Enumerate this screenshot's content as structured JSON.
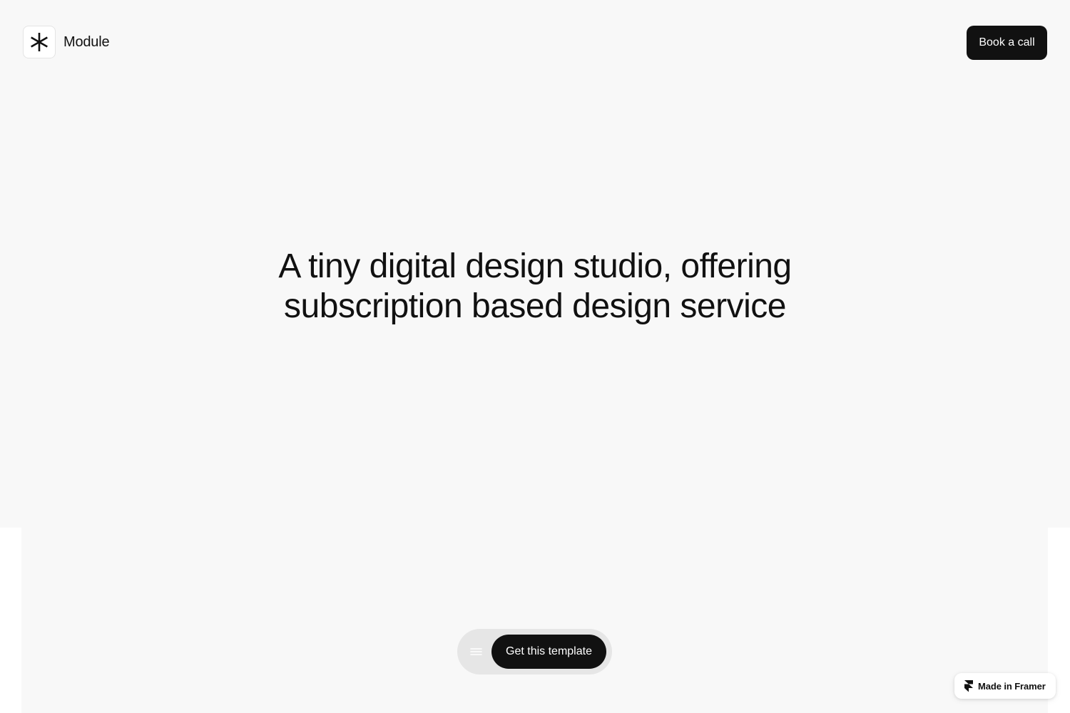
{
  "header": {
    "brand_name": "Module",
    "logo_icon": "asterisk-logo-icon",
    "cta_label": "Book a call"
  },
  "hero": {
    "headline_line1": "A tiny digital design studio, offering",
    "headline_line2": "subscription based design service"
  },
  "dock": {
    "menu_icon": "hamburger-menu-icon",
    "cta_label": "Get this template"
  },
  "badge": {
    "icon": "framer-logo-icon",
    "label": "Made in Framer"
  },
  "colors": {
    "background": "#f8f8f8",
    "text": "#111111",
    "button": "#111111",
    "button_text": "#ffffff",
    "dock": "#e6e6e6"
  }
}
